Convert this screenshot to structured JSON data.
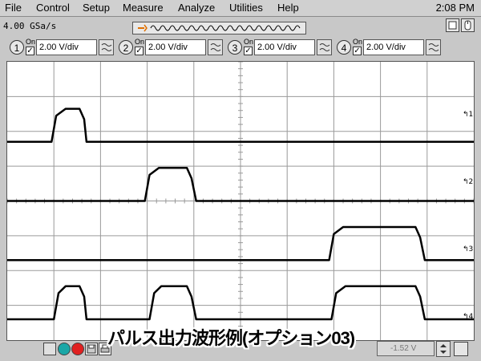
{
  "menu": {
    "items": [
      "File",
      "Control",
      "Setup",
      "Measure",
      "Analyze",
      "Utilities",
      "Help"
    ],
    "clock": "2:08 PM"
  },
  "toolbar": {
    "sample_rate": "4.00 GSa/s"
  },
  "channels": [
    {
      "number": "1",
      "on_label": "On",
      "checked": true,
      "scale": "2.00 V/div"
    },
    {
      "number": "2",
      "on_label": "On",
      "checked": true,
      "scale": "2.00 V/div"
    },
    {
      "number": "3",
      "on_label": "On",
      "checked": true,
      "scale": "2.00 V/div"
    },
    {
      "number": "4",
      "on_label": "On",
      "checked": true,
      "scale": "2.00 V/div"
    }
  ],
  "markers": [
    "1",
    "2",
    "3",
    "4"
  ],
  "bottom": {
    "level": "-1.52 V"
  },
  "caption": "パルス出力波形例(オプション03)",
  "colors": {
    "window_bg": "#c8c8c8",
    "screen_bg": "#ffffff",
    "grid": "#9a9a9a",
    "trace": "#000000",
    "button_teal": "#1aa7a7",
    "button_red": "#e02020"
  },
  "chart_data": {
    "type": "line",
    "title": "",
    "xlabel": "",
    "ylabel": "",
    "x_divisions": 10,
    "y_divisions": 8,
    "xlim": [
      0,
      10
    ],
    "ylim": [
      0,
      8
    ],
    "series": [
      {
        "points": [
          [
            0,
            5.7
          ],
          [
            0.95,
            5.7
          ],
          [
            1.05,
            6.45
          ],
          [
            1.25,
            6.65
          ],
          [
            1.55,
            6.65
          ],
          [
            1.65,
            6.35
          ],
          [
            1.7,
            5.7
          ],
          [
            10,
            5.7
          ]
        ]
      },
      {
        "points": [
          [
            0,
            4.0
          ],
          [
            2.95,
            4.0
          ],
          [
            3.05,
            4.75
          ],
          [
            3.25,
            4.95
          ],
          [
            3.85,
            4.95
          ],
          [
            3.95,
            4.65
          ],
          [
            4.05,
            4.0
          ],
          [
            10,
            4.0
          ]
        ]
      },
      {
        "points": [
          [
            0,
            2.3
          ],
          [
            6.9,
            2.3
          ],
          [
            7.0,
            3.05
          ],
          [
            7.2,
            3.25
          ],
          [
            8.75,
            3.25
          ],
          [
            8.85,
            2.95
          ],
          [
            8.95,
            2.3
          ],
          [
            10,
            2.3
          ]
        ]
      },
      {
        "points": [
          [
            0,
            0.6
          ],
          [
            1.0,
            0.6
          ],
          [
            1.1,
            1.35
          ],
          [
            1.25,
            1.55
          ],
          [
            1.55,
            1.55
          ],
          [
            1.65,
            1.25
          ],
          [
            1.7,
            0.6
          ],
          [
            3.05,
            0.6
          ],
          [
            3.15,
            1.35
          ],
          [
            3.3,
            1.55
          ],
          [
            3.85,
            1.55
          ],
          [
            3.95,
            1.25
          ],
          [
            4.05,
            0.6
          ],
          [
            6.95,
            0.6
          ],
          [
            7.05,
            1.35
          ],
          [
            7.25,
            1.55
          ],
          [
            8.75,
            1.55
          ],
          [
            8.85,
            1.25
          ],
          [
            8.95,
            0.6
          ],
          [
            10,
            0.6
          ]
        ]
      }
    ]
  }
}
